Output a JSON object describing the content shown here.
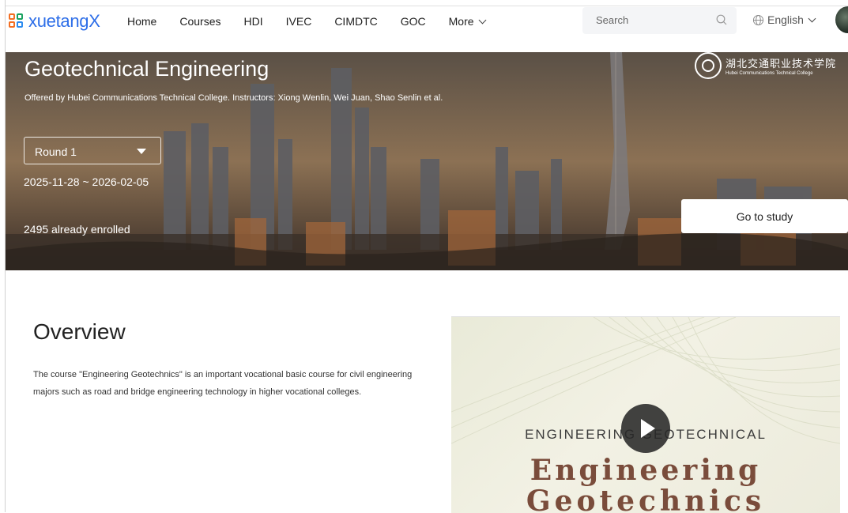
{
  "header": {
    "logo_text": "xuetangX",
    "nav": [
      {
        "label": "Home"
      },
      {
        "label": "Courses"
      },
      {
        "label": "HDI"
      },
      {
        "label": "IVEC"
      },
      {
        "label": "CIMDTC"
      },
      {
        "label": "GOC"
      },
      {
        "label": "More"
      }
    ],
    "search_placeholder": "Search",
    "language": "English"
  },
  "banner": {
    "title": "Geotechnical Engineering",
    "subtitle": "Offered by Hubei Communications Technical College. Instructors: Xiong Wenlin, Wei Juan, Shao Senlin et al.",
    "round_select": "Round 1",
    "dates": "2025-11-28 ~ 2026-02-05",
    "enrolled": "2495 already enrolled",
    "cta": "Go to study",
    "college_name_cn": "湖北交通职业技术学院",
    "college_name_en": "Hubei Communications Technical College"
  },
  "overview": {
    "title": "Overview",
    "description": "The course \"Engineering Geotechnics\" is an important vocational basic course for civil engineering majors such as road and bridge engineering technology in higher vocational colleges."
  },
  "video": {
    "caption_small": "ENGINEERING GEOTECHNICAL",
    "caption_line1": "Engineering",
    "caption_line2": "Geotechnics"
  },
  "colors": {
    "brand_blue": "#2d6ee8",
    "title_brown": "#7a4c3b"
  }
}
